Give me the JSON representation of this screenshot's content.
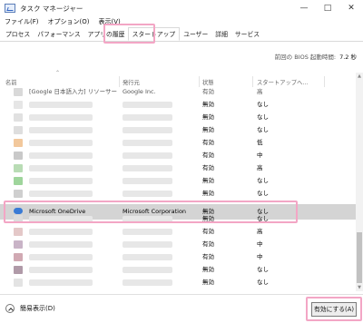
{
  "window": {
    "title": "タスク マネージャー"
  },
  "menu": [
    "ファイル(F)",
    "オプション(O)",
    "表示(V)"
  ],
  "tabs": [
    {
      "label": "プロセス",
      "active": false
    },
    {
      "label": "パフォーマンス",
      "active": false
    },
    {
      "label": "アプリの履歴",
      "active": false
    },
    {
      "label": "スタートアップ",
      "active": true
    },
    {
      "label": "ユーザー",
      "active": false
    },
    {
      "label": "詳細",
      "active": false
    },
    {
      "label": "サービス",
      "active": false
    }
  ],
  "bios": {
    "label": "前回の BIOS 起動時間:",
    "value": "7.2 秒"
  },
  "columns": {
    "name": "名前",
    "publisher": "発行元",
    "status": "状態",
    "impact": "スタートアップへ..."
  },
  "rows": [
    {
      "name": "[Google 日本語入力] リソーサー",
      "publisher": "Google Inc.",
      "status": "有効",
      "impact": "高",
      "icon_color": "#d9d9d9",
      "blurred": false,
      "partial": true
    },
    {
      "name": "",
      "publisher": "",
      "status": "無効",
      "impact": "なし",
      "icon_color": "#e6e6e6",
      "blurred": true
    },
    {
      "name": "",
      "publisher": "",
      "status": "無効",
      "impact": "なし",
      "icon_color": "#e1e1e1",
      "blurred": true
    },
    {
      "name": "",
      "publisher": "",
      "status": "無効",
      "impact": "なし",
      "icon_color": "#dedede",
      "blurred": true
    },
    {
      "name": "",
      "publisher": "",
      "status": "有効",
      "impact": "低",
      "icon_color": "#f2c89c",
      "blurred": true
    },
    {
      "name": "",
      "publisher": "",
      "status": "有効",
      "impact": "中",
      "icon_color": "#c9c9c9",
      "blurred": true
    },
    {
      "name": "",
      "publisher": "",
      "status": "有効",
      "impact": "高",
      "icon_color": "#b9dcb5",
      "blurred": true
    },
    {
      "name": "",
      "publisher": "",
      "status": "無効",
      "impact": "なし",
      "icon_color": "#9fd59c",
      "blurred": true
    },
    {
      "name": "",
      "publisher": "",
      "status": "無効",
      "impact": "なし",
      "icon_color": "#cfcfcf",
      "blurred": true
    },
    {
      "name": "Microsoft OneDrive",
      "publisher": "Microsoft Corporation",
      "status": "無効",
      "impact": "なし",
      "icon_color": "#3a7bd5",
      "blurred": false,
      "selected": true
    },
    {
      "name": "",
      "publisher": "",
      "status": "無効",
      "impact": "なし",
      "icon_color": "#dcdcdc",
      "blurred": true
    },
    {
      "name": "",
      "publisher": "",
      "status": "有効",
      "impact": "高",
      "icon_color": "#e4c8c8",
      "blurred": true
    },
    {
      "name": "",
      "publisher": "",
      "status": "有効",
      "impact": "中",
      "icon_color": "#c9b4c7",
      "blurred": true
    },
    {
      "name": "",
      "publisher": "",
      "status": "有効",
      "impact": "中",
      "icon_color": "#d1a9b3",
      "blurred": true
    },
    {
      "name": "",
      "publisher": "",
      "status": "無効",
      "impact": "なし",
      "icon_color": "#b09aa8",
      "blurred": true
    },
    {
      "name": "",
      "publisher": "",
      "status": "無効",
      "impact": "なし",
      "icon_color": "#e3e3e3",
      "blurred": true
    }
  ],
  "footer": {
    "less_details": "簡易表示(D)",
    "enable_button": "有効にする(A)"
  },
  "colors": {
    "highlight": "#f3a6c5",
    "selected_row": "#d4d4d4",
    "onedrive_icon": "#3a7bd5"
  }
}
